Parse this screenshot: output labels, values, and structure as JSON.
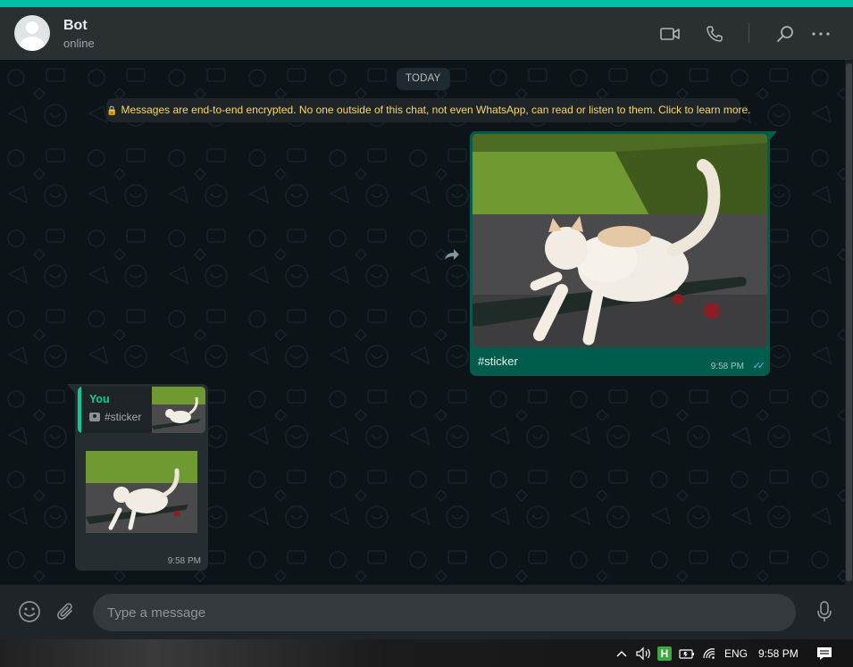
{
  "header": {
    "contact_name": "Bot",
    "contact_status": "online",
    "icons": [
      "video-call-icon",
      "voice-call-icon",
      "search-icon",
      "menu-icon"
    ]
  },
  "chat": {
    "date_label": "TODAY",
    "encryption_notice": "Messages are end-to-end encrypted. No one outside of this chat, not even WhatsApp, can read or listen to them. Click to learn more.",
    "outgoing": {
      "image_desc": "cat on skateboard",
      "caption": "#sticker",
      "time": "9:58 PM",
      "ticks": "✓✓"
    },
    "incoming": {
      "quote_author": "You",
      "quote_text": "#sticker",
      "time": "9:58 PM"
    }
  },
  "composer": {
    "placeholder": "Type a message"
  },
  "taskbar": {
    "language": "ENG",
    "clock": "9:58 PM",
    "h_badge": "H"
  },
  "colors": {
    "accent": "#00bfa5",
    "outgoing_bubble": "#005c4b",
    "incoming_bubble": "#262d31",
    "read_ticks": "#53bdeb",
    "notice_text": "#fad964"
  }
}
